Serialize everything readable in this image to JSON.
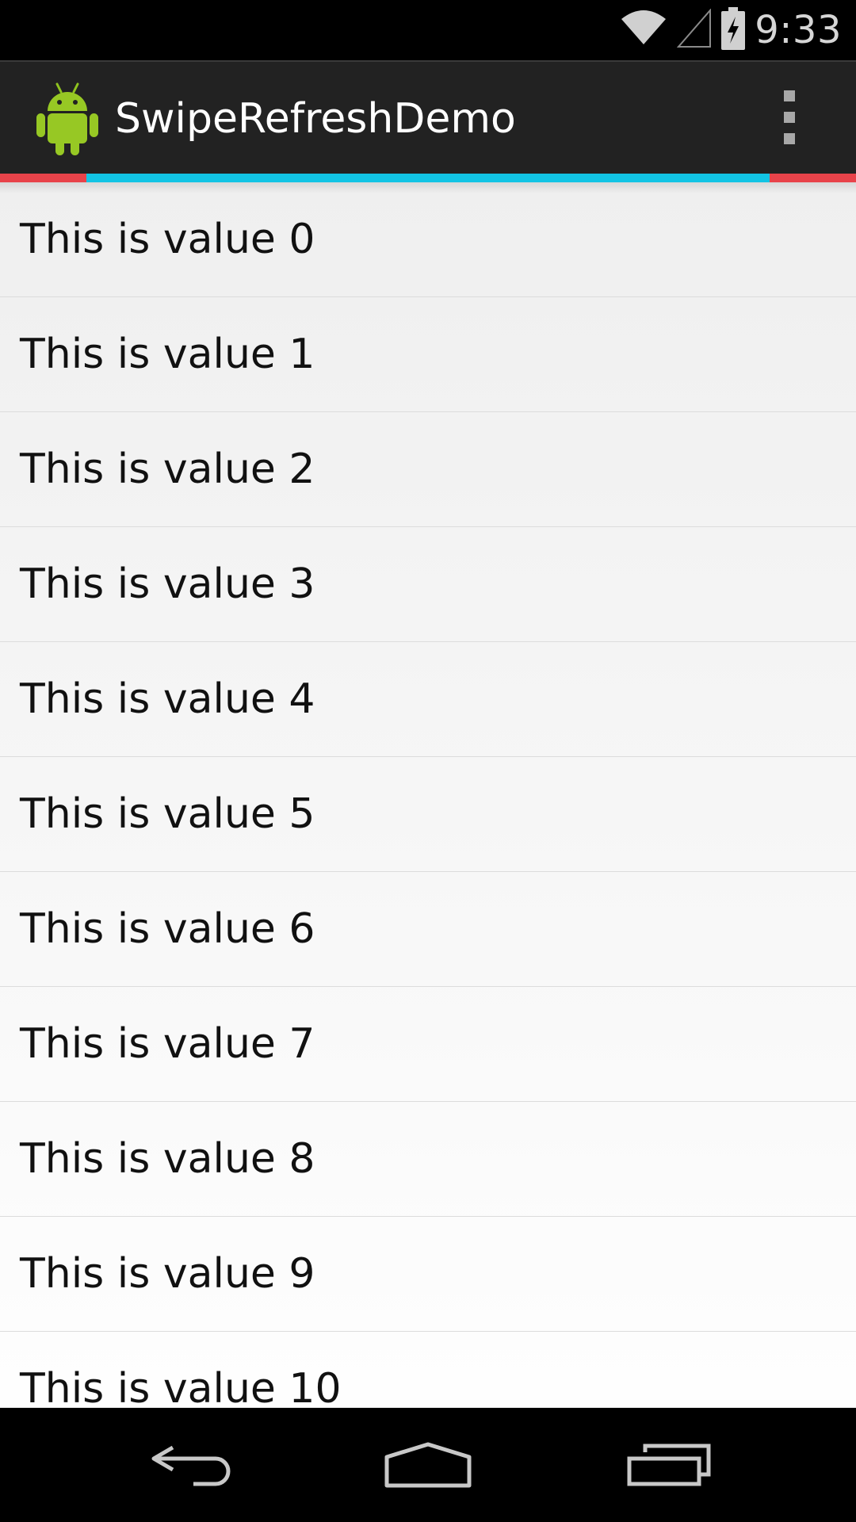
{
  "status_bar": {
    "time": "9:33",
    "icons": [
      "wifi-icon",
      "cell-signal-icon",
      "battery-charging-icon"
    ]
  },
  "action_bar": {
    "app_icon": "android-robot-icon",
    "title": "SwipeRefreshDemo",
    "overflow_icon": "overflow-menu-icon"
  },
  "refresh_progress": {
    "colors": {
      "outer": "#e8434a",
      "inner": "#12c4e4"
    }
  },
  "list": {
    "items": [
      "This is value 0",
      "This is value 1",
      "This is value 2",
      "This is value 3",
      "This is value 4",
      "This is value 5",
      "This is value 6",
      "This is value 7",
      "This is value 8",
      "This is value 9",
      "This is value 10"
    ]
  },
  "nav_bar": {
    "icons": [
      "back-icon",
      "home-icon",
      "recents-icon"
    ]
  },
  "colors": {
    "status_bar_bg": "#000000",
    "action_bar_bg": "#222222",
    "list_bg": "#f4f4f4",
    "nav_bar_bg": "#000000"
  }
}
